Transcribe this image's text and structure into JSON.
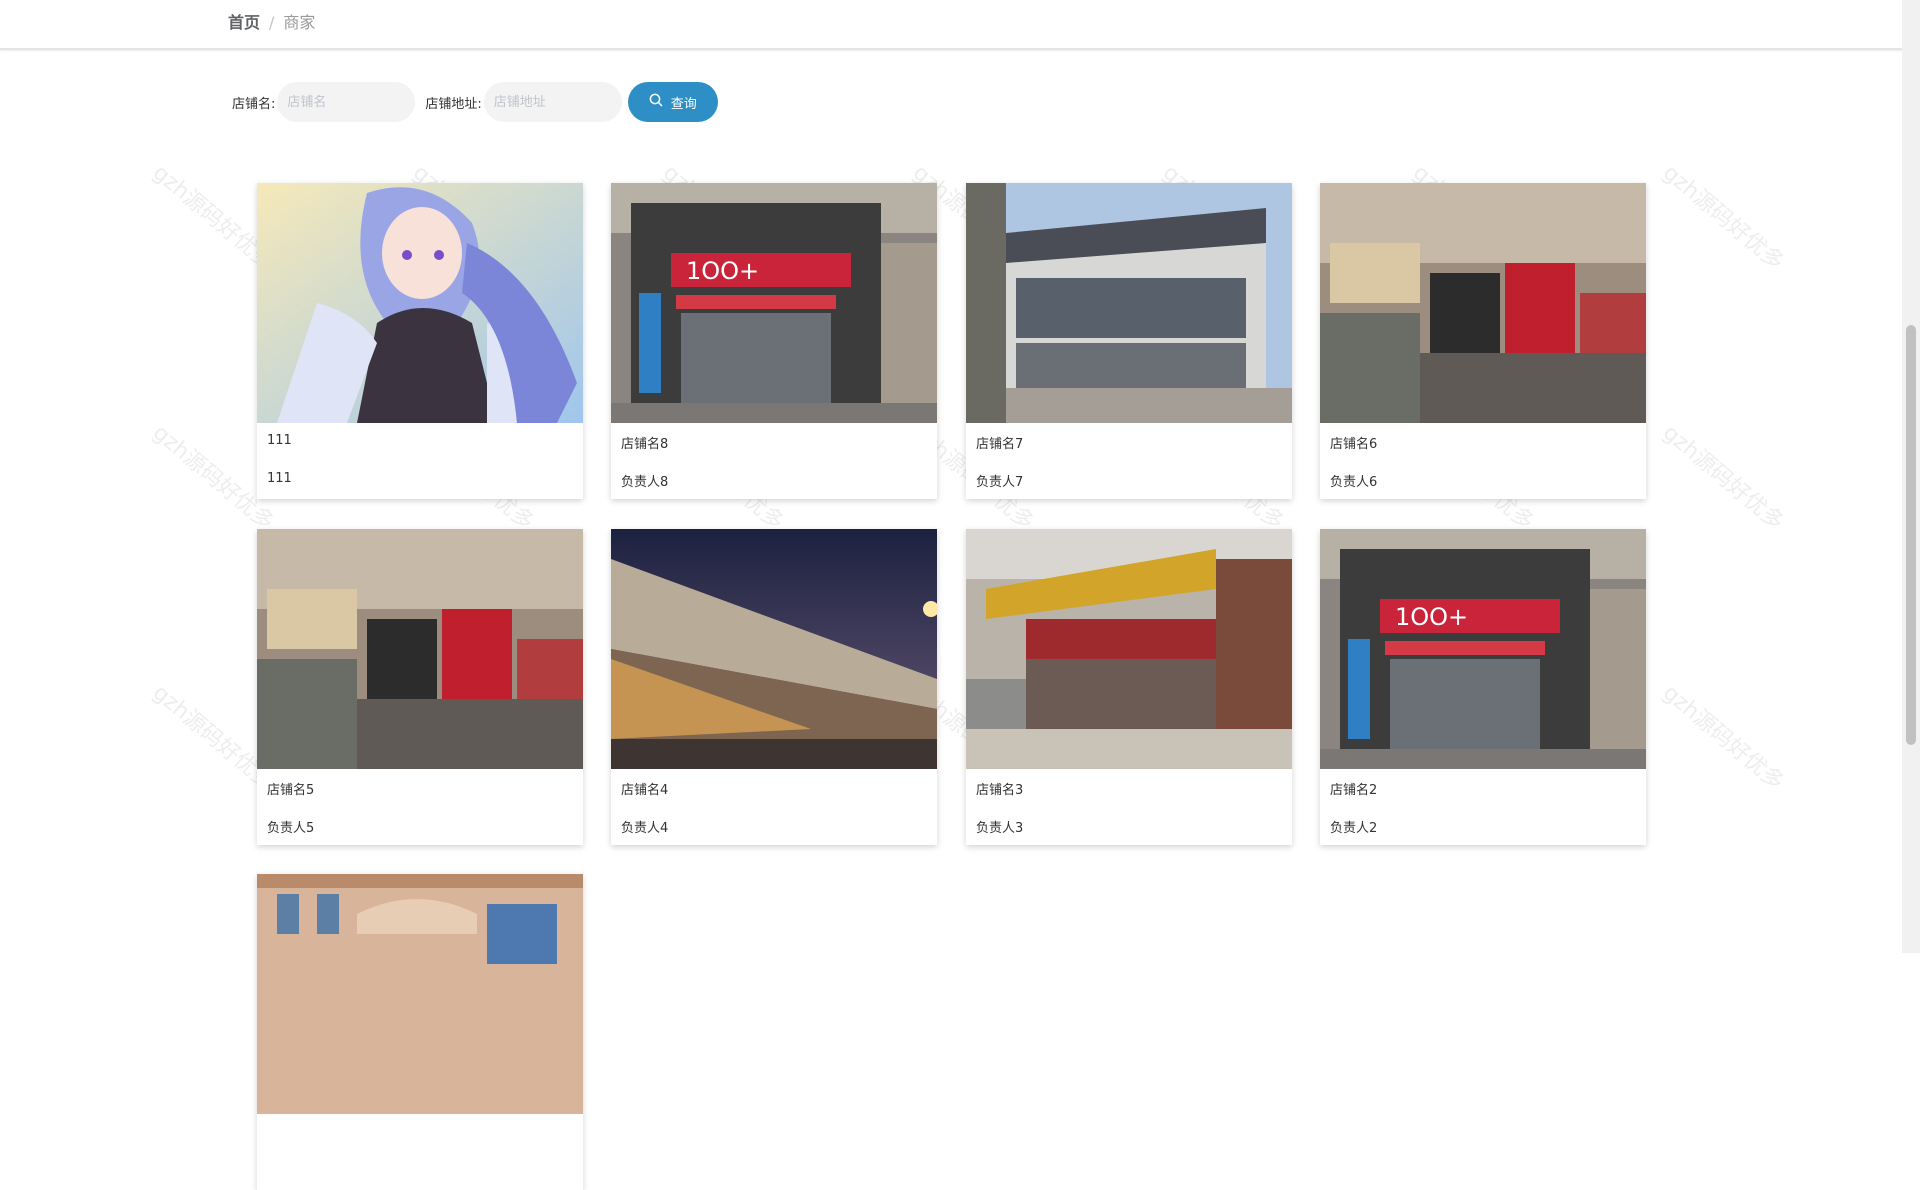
{
  "breadcrumb": {
    "home": "首页",
    "separator": "/",
    "current": "商家"
  },
  "search": {
    "shop_name_label": "店铺名:",
    "shop_name_placeholder": "店铺名",
    "shop_address_label": "店铺地址:",
    "shop_address_placeholder": "店铺地址",
    "button_label": "查询",
    "button_icon": "search-icon",
    "button_color": "#2e8fc6"
  },
  "shops": [
    {
      "name": "111",
      "owner": "111",
      "image": "anime-character-illustration"
    },
    {
      "name": "店铺名8",
      "owner": "负责人8",
      "image": "convenience-store-100plus"
    },
    {
      "name": "店铺名7",
      "owner": "负责人7",
      "image": "grey-commercial-building"
    },
    {
      "name": "店铺名6",
      "owner": "负责人6",
      "image": "street-storefronts"
    },
    {
      "name": "店铺名5",
      "owner": "负责人5",
      "image": "street-storefronts"
    },
    {
      "name": "店铺名4",
      "owner": "负责人4",
      "image": "commercial-street-night"
    },
    {
      "name": "店铺名3",
      "owner": "负责人3",
      "image": "tea-shop-street"
    },
    {
      "name": "店铺名2",
      "owner": "负责人2",
      "image": "convenience-store-100plus"
    },
    {
      "name": "",
      "owner": "",
      "image": "european-style-building"
    }
  ],
  "watermark": "gzh源码好优多"
}
